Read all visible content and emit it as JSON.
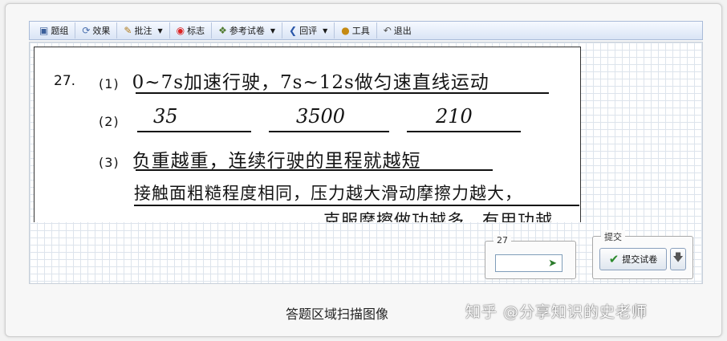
{
  "toolbar": {
    "items": [
      {
        "label": "题组",
        "icon": "doc-icon"
      },
      {
        "label": "效果",
        "icon": "effect-icon"
      },
      {
        "label": "批注",
        "icon": "pencil-icon",
        "dropdown": true
      },
      {
        "label": "标志",
        "icon": "mark-icon"
      },
      {
        "label": "参考试卷",
        "icon": "paper-icon",
        "dropdown": true
      },
      {
        "label": "回评",
        "icon": "back-arrow-icon",
        "dropdown": true
      },
      {
        "label": "工具",
        "icon": "tool-icon"
      },
      {
        "label": "退出",
        "icon": "exit-icon"
      }
    ]
  },
  "answer": {
    "question_number": "27.",
    "line1_prefix": "(1)",
    "line1_text": "0~7s加速行驶，7s~12s做匀速直线运动",
    "line2_prefix": "(2)",
    "line2_a": "35",
    "line2_b": "3500",
    "line2_c": "210",
    "line3_prefix": "(3)",
    "line3_text": "负重越重，连续行驶的里程就越短",
    "line4_text": "接触面粗糙程度相同，压力越大滑动摩擦力越大，",
    "line5_text": "克服摩擦做功越多，有用功越"
  },
  "score_panel": {
    "legend": "27",
    "input_value": ""
  },
  "submit_panel": {
    "legend": "提交",
    "button_label": "提交试卷"
  },
  "caption": "答题区域扫描图像",
  "watermark": "知乎 @分享知识的史老师"
}
